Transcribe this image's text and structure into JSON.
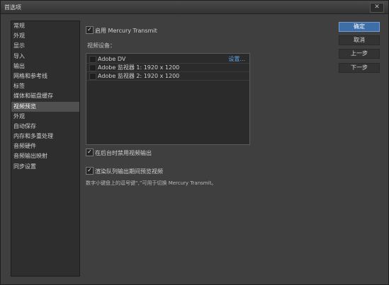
{
  "window": {
    "title": "首选项",
    "close_label": "✕"
  },
  "sidebar": {
    "items": [
      {
        "label": "常规"
      },
      {
        "label": "外观"
      },
      {
        "label": "显示"
      },
      {
        "label": "导入"
      },
      {
        "label": "输出"
      },
      {
        "label": "网格和参考线"
      },
      {
        "label": "标签"
      },
      {
        "label": "媒体和磁盘缓存"
      },
      {
        "label": "视频预览"
      },
      {
        "label": "外观"
      },
      {
        "label": "自动保存"
      },
      {
        "label": "内存和多重处理"
      },
      {
        "label": "音频硬件"
      },
      {
        "label": "音频输出映射"
      },
      {
        "label": "同步设置"
      }
    ],
    "selected_index": 8
  },
  "content": {
    "enable_mercury": {
      "checked": true,
      "label": "启用 Mercury Transmit"
    },
    "devices_label": "视频设备：",
    "devices": [
      {
        "name": "Adobe DV",
        "checked": false,
        "link": "设置..."
      },
      {
        "name": "Adobe 监视器 1: 1920 x 1200",
        "checked": false
      },
      {
        "name": "Adobe 监视器 2: 1920 x 1200",
        "checked": false
      }
    ],
    "disable_background": {
      "checked": true,
      "label": "在后台时禁用视频输出"
    },
    "render_queue": {
      "checked": true,
      "label": "渲染队列输出期间预览视频"
    },
    "note": "数字小键盘上的逗号键“,”可用于切换 Mercury Transmit。"
  },
  "buttons": {
    "ok": "确定",
    "cancel": "取消",
    "prev": "上一步",
    "next": "下一步"
  }
}
